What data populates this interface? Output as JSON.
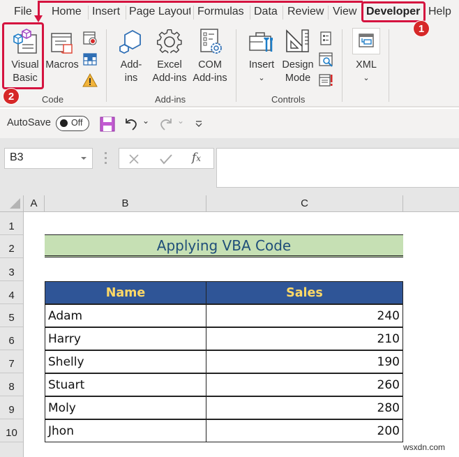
{
  "ribbon_tabs": [
    {
      "label": "File"
    },
    {
      "label": "Home"
    },
    {
      "label": "Insert"
    },
    {
      "label": "Page Layout"
    },
    {
      "label": "Formulas"
    },
    {
      "label": "Data"
    },
    {
      "label": "Review"
    },
    {
      "label": "View"
    },
    {
      "label": "Developer",
      "active": true
    },
    {
      "label": "Help"
    }
  ],
  "ribbon": {
    "code": {
      "label": "Code",
      "visual_basic": [
        "Visual",
        "Basic"
      ],
      "macros": "Macros"
    },
    "addins": {
      "label": "Add-ins",
      "addins_btn": [
        "Add-",
        "ins"
      ],
      "excel_addins": [
        "Excel",
        "Add-ins"
      ],
      "com_addins": [
        "COM",
        "Add-ins"
      ]
    },
    "controls": {
      "label": "Controls",
      "insert": "Insert",
      "design_mode": [
        "Design",
        "Mode"
      ]
    },
    "xml": {
      "label": "XML"
    }
  },
  "qat": {
    "autosave_label": "AutoSave",
    "autosave_state": "Off"
  },
  "formula_bar": {
    "name_box": "B3",
    "formula": ""
  },
  "grid": {
    "columns": [
      "A",
      "B",
      "C"
    ],
    "rows": [
      "1",
      "2",
      "3",
      "4",
      "5",
      "6",
      "7",
      "8",
      "9",
      "10"
    ],
    "title": "Applying VBA Code",
    "table_headers": [
      "Name",
      "Sales"
    ],
    "table_rows": [
      {
        "name": "Adam",
        "sales": "240"
      },
      {
        "name": "Harry",
        "sales": "210"
      },
      {
        "name": "Shelly",
        "sales": "190"
      },
      {
        "name": "Stuart",
        "sales": "260"
      },
      {
        "name": "Moly",
        "sales": "280"
      },
      {
        "name": "Jhon",
        "sales": "200"
      }
    ]
  },
  "annotations": {
    "step1": "1",
    "step2": "2"
  },
  "watermark": "wsxdn.com",
  "colors": {
    "accent_red": "#d5133f",
    "header_blue": "#2f5597",
    "header_text": "#ffd966",
    "title_green": "#c6e0b4",
    "title_text": "#1f4e79"
  }
}
